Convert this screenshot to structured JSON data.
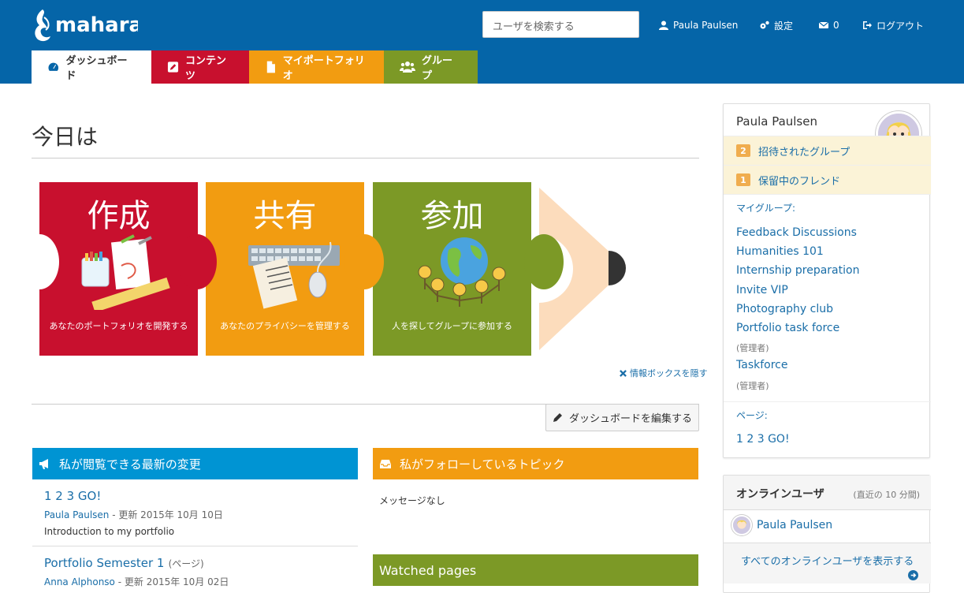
{
  "header": {
    "logo": "mahara",
    "search_placeholder": "ユーザを検索する",
    "user_name": "Paula Paulsen",
    "settings": "設定",
    "messages_count": "0",
    "logout": "ログアウト"
  },
  "tabs": [
    {
      "label": "ダッシュボード"
    },
    {
      "label": "コンテンツ"
    },
    {
      "label": "マイポートフォリオ"
    },
    {
      "label": "グループ"
    }
  ],
  "page_title": "今日は",
  "puzzles": [
    {
      "big": "作成",
      "small": "あなたのポートフォリオを開発する"
    },
    {
      "big": "共有",
      "small": "あなたのプライバシーを管理する"
    },
    {
      "big": "参加",
      "small": "人を探してグループに参加する"
    }
  ],
  "hide_infobox": "情報ボックスを隠す",
  "edit_dashboard": "ダッシュボードを編集する",
  "recent": {
    "title": "私が閲覧できる最新の変更",
    "items": [
      {
        "title": "1 2 3 GO!",
        "author": "Paula Paulsen",
        "meta": "- 更新 2015年 10月 10日",
        "desc": "Introduction to my portfolio"
      },
      {
        "title": "Portfolio Semester 1",
        "tag": "(ページ)",
        "author": "Anna Alphonso",
        "meta": "- 更新 2015年 10月 02日"
      }
    ]
  },
  "followed": {
    "title": "私がフォローしているトピック",
    "empty": "メッセージなし"
  },
  "watched": {
    "title": "Watched pages"
  },
  "profile": {
    "name": "Paula Paulsen",
    "notices": [
      {
        "count": "2",
        "label": "招待されたグループ"
      },
      {
        "count": "1",
        "label": "保留中のフレンド"
      }
    ],
    "my_groups_label": "マイグループ:",
    "groups": [
      {
        "name": "Feedback Discussions"
      },
      {
        "name": "Humanities 101"
      },
      {
        "name": "Internship preparation"
      },
      {
        "name": "Invite VIP"
      },
      {
        "name": "Photography club"
      },
      {
        "name": "Portfolio task force",
        "sub": "(管理者)"
      },
      {
        "name": "Taskforce",
        "sub": "(管理者)"
      }
    ],
    "pages_label": "ページ:",
    "pages": [
      {
        "name": "1 2 3 GO!"
      }
    ]
  },
  "online": {
    "title": "オンラインユーザ",
    "subtitle": "(直近の 10 分間)",
    "users": [
      {
        "name": "Paula Paulsen"
      }
    ],
    "show_all": "すべてのオンラインユーザを表示する"
  },
  "colors": {
    "header": "#0565a8",
    "content": "#c8102e",
    "portfolio": "#f29c11",
    "groups": "#7c9926",
    "recent": "#0094d3"
  }
}
